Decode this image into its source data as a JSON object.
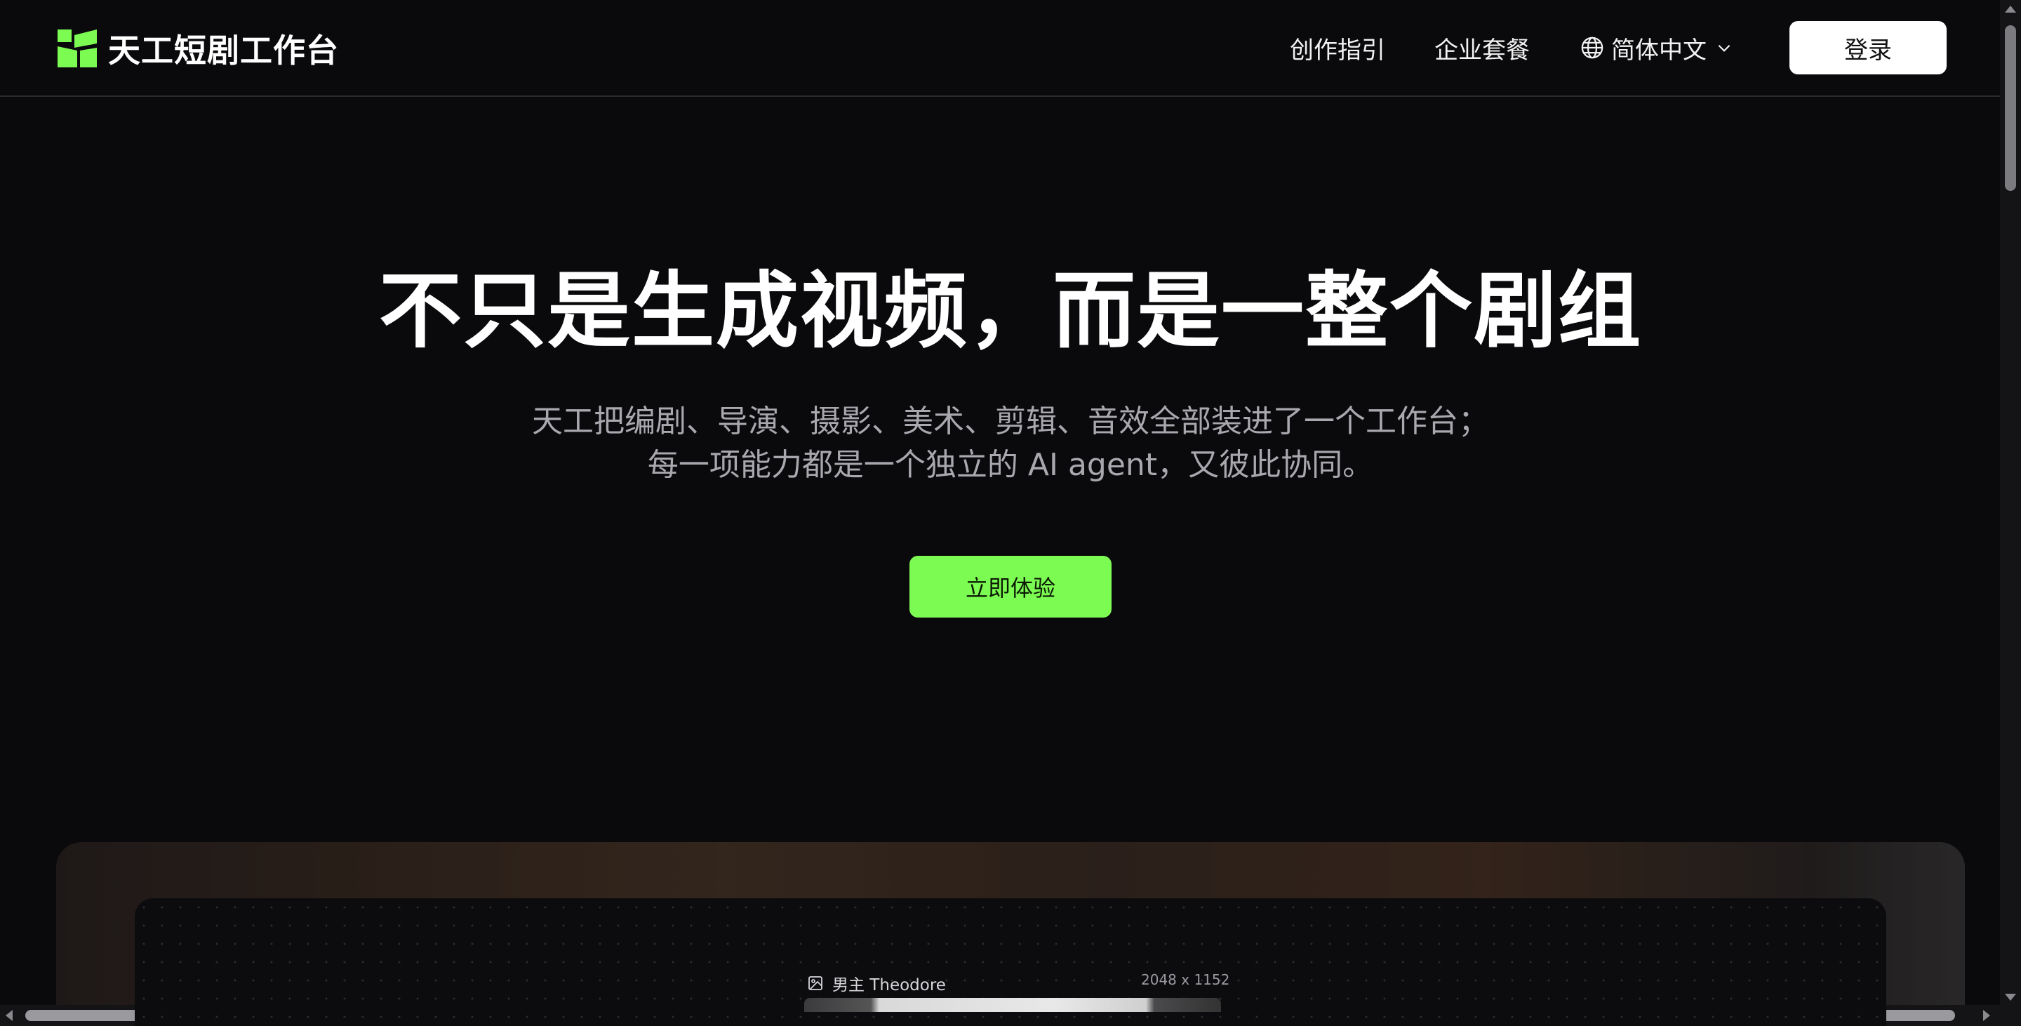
{
  "brand": {
    "name": "天工短剧工作台",
    "logo_icon": "skywork-logo-icon",
    "accent_color": "#7cfb52"
  },
  "nav": {
    "guide_label": "创作指引",
    "enterprise_label": "企业套餐",
    "language_label": "简体中文",
    "language_icon": "globe-icon",
    "login_label": "登录"
  },
  "hero": {
    "title": "不只是生成视频，而是一整个剧组",
    "subtitle_line1": "天工把编剧、导演、摄影、美术、剪辑、音效全部装进了一个工作台；",
    "subtitle_line2": "每一项能力都是一个独立的 AI agent，又彼此协同。",
    "cta_label": "立即体验"
  },
  "showcase": {
    "asset_name": "男主 Theodore",
    "asset_size": "2048 x 1152",
    "asset_icon": "image-icon"
  }
}
